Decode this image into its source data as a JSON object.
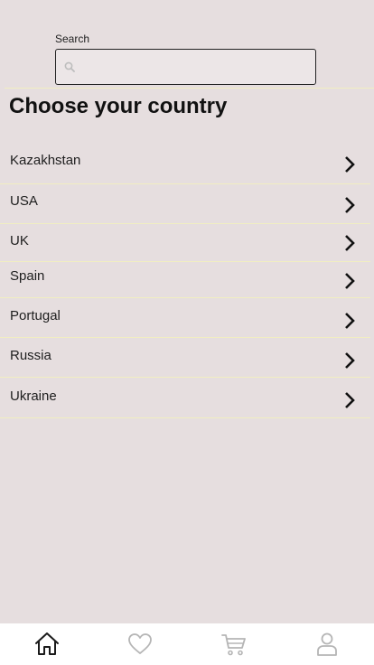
{
  "search": {
    "label": "Search",
    "placeholder": "",
    "value": ""
  },
  "title": "Choose your country",
  "countries": [
    {
      "label": "Kazakhstan"
    },
    {
      "label": "USA"
    },
    {
      "label": "UK"
    },
    {
      "label": "Spain"
    },
    {
      "label": "Portugal"
    },
    {
      "label": "Russia"
    },
    {
      "label": "Ukraine"
    }
  ],
  "tabbar": {
    "items": [
      {
        "icon": "home-icon",
        "active": true
      },
      {
        "icon": "heart-icon",
        "active": false
      },
      {
        "icon": "cart-icon",
        "active": false
      },
      {
        "icon": "user-icon",
        "active": false
      }
    ]
  },
  "colors": {
    "background": "#e6dedf",
    "divider": "#f1eec2",
    "tab_active": "#1a1a1a",
    "tab_inactive": "#b5b5b5"
  }
}
